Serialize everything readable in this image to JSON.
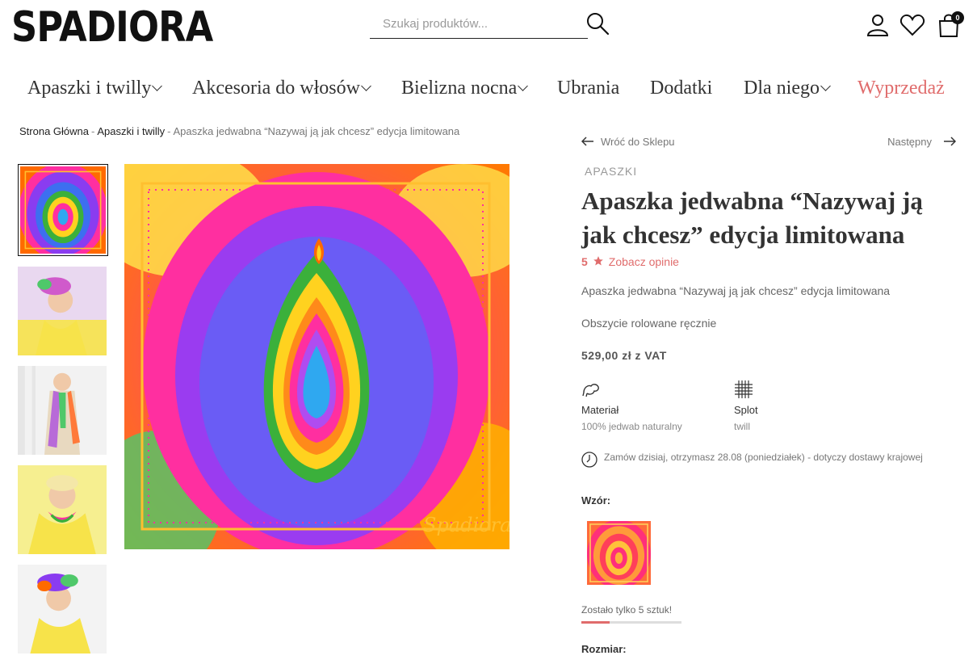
{
  "header": {
    "logo": "SPADIORA",
    "search_placeholder": "Szukaj produktów...",
    "cart_count": "0"
  },
  "nav": {
    "items": [
      {
        "label": "Apaszki i twilly",
        "dropdown": true
      },
      {
        "label": "Akcesoria do włosów",
        "dropdown": true
      },
      {
        "label": "Bielizna nocna",
        "dropdown": true
      },
      {
        "label": "Ubrania",
        "dropdown": false
      },
      {
        "label": "Dodatki",
        "dropdown": false
      },
      {
        "label": "Dla niego",
        "dropdown": true
      },
      {
        "label": "Wyprzedaż",
        "dropdown": false
      }
    ],
    "sale_color": "#e06c6c"
  },
  "breadcrumb": {
    "home": "Strona Główna",
    "sep": "-",
    "category": "Apaszki i twilly",
    "current": "Apaszka jedwabna “Nazywaj ją jak chcesz” edycja limitowana"
  },
  "product_nav": {
    "back": "Wróć do Sklepu",
    "next": "Następny"
  },
  "product": {
    "category": "APASZKI",
    "title": "Apaszka jedwabna “Nazywaj ją jak chcesz” edycja limitowana",
    "rating": "5",
    "reviews_link": "Zobacz opinie",
    "desc_1": "Apaszka jedwabna “Nazywaj ją jak chcesz” edycja limitowana",
    "desc_2": "Obszycie rolowane ręcznie",
    "price": "529,00 zł z VAT",
    "features": [
      {
        "label": "Materiał",
        "value": "100% jedwab naturalny",
        "icon": "silkworm-icon"
      },
      {
        "label": "Splot",
        "value": "twill",
        "icon": "weave-icon"
      }
    ],
    "delivery": "Zamów dzisiaj, otrzymasz 28.08 (poniedziałek) - dotyczy dostawy krajowej",
    "pattern_label": "Wzór:",
    "stock_text": "Zostało tylko 5 sztuk!",
    "stock_fraction": 0.28,
    "size_label": "Rozmiar:",
    "accent_color": "#e06c6c"
  }
}
